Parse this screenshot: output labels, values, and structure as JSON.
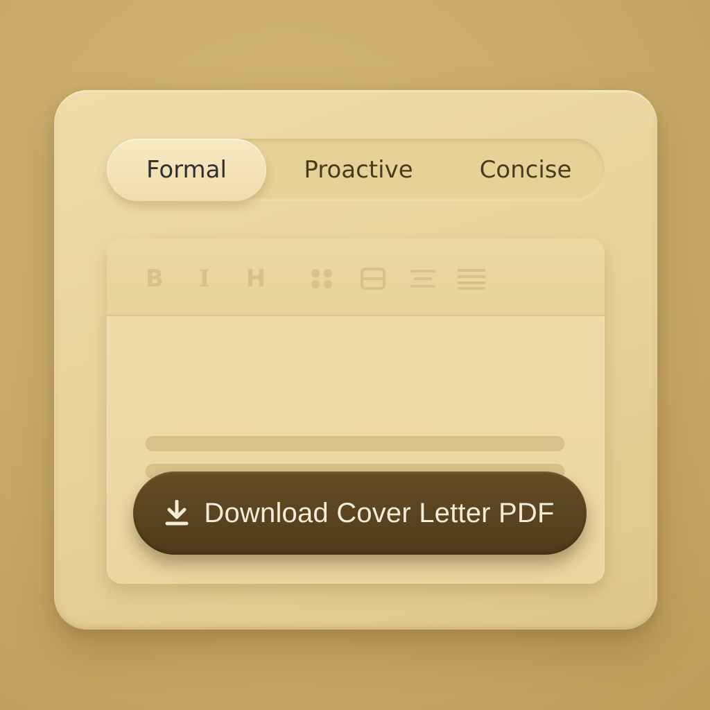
{
  "tabs": [
    {
      "label": "Formal",
      "active": true
    },
    {
      "label": "Proactive",
      "active": false
    },
    {
      "label": "Concise",
      "active": false
    }
  ],
  "toolbar": {
    "bold_glyph": "B",
    "italic_glyph": "I",
    "heading_glyph": "H",
    "icons": [
      "bold-icon",
      "italic-icon",
      "heading-icon",
      "list-dots-icon",
      "block-icon",
      "align-center-icon",
      "align-justify-icon"
    ]
  },
  "download": {
    "label": "Download Cover Letter PDF",
    "icon": "download-icon"
  },
  "colors": {
    "background": "#c8aa68",
    "card": "#e7d199",
    "button": "#5a4320",
    "button_text": "#f6ecd6",
    "placeholder_line": "#d9c28b"
  }
}
